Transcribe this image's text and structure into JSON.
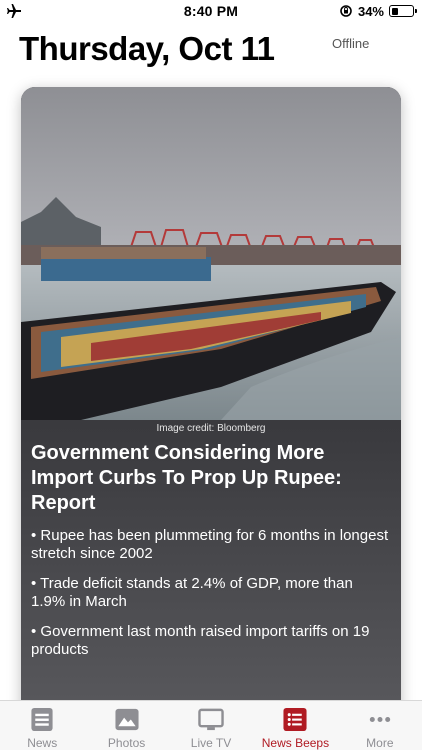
{
  "status_bar": {
    "time": "8:40 PM",
    "battery": "34%",
    "battery_level": 0.34
  },
  "header": {
    "date": "Thursday, Oct 11",
    "offline": "Offline"
  },
  "card": {
    "image_credit": "Image credit: Bloomberg",
    "headline": "Government Considering More Import Curbs To Prop Up Rupee: Report",
    "bullets": [
      "• Rupee has been plummeting for 6 months in longest stretch since 2002",
      "• Trade deficit stands at 2.4% of GDP, more than 1.9% in March",
      "• Government last month raised import tariffs on 19 products"
    ]
  },
  "tabs": [
    {
      "label": "News",
      "icon": "news-icon"
    },
    {
      "label": "Photos",
      "icon": "photos-icon"
    },
    {
      "label": "Live TV",
      "icon": "tv-icon"
    },
    {
      "label": "News Beeps",
      "icon": "news-beeps-icon"
    },
    {
      "label": "More",
      "icon": "more-icon"
    }
  ],
  "colors": {
    "accent": "#b01b23",
    "inactive": "#8e8e93"
  }
}
